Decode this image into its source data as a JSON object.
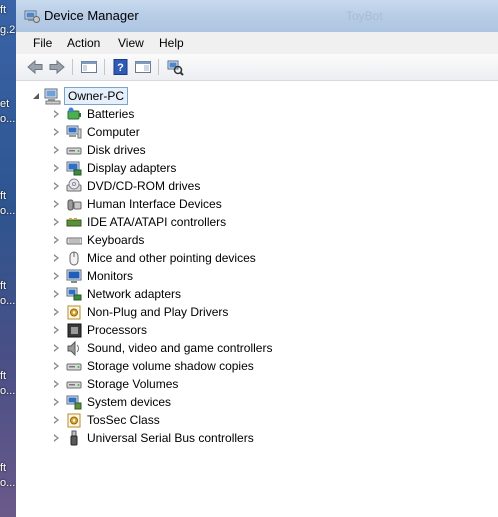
{
  "desktop": {
    "fragments": [
      "ft",
      "g.2",
      "et",
      "o...",
      "ft",
      "o...",
      "ft",
      "o...",
      "ft",
      "o...",
      "ft",
      "o..."
    ]
  },
  "window": {
    "title": "Device Manager",
    "ghost_title": "ToyBot"
  },
  "menu": {
    "file": "File",
    "action": "Action",
    "view": "View",
    "help": "Help"
  },
  "toolbar": {
    "buttons": [
      "back-icon",
      "forward-icon",
      "show-hide-console-tree-icon",
      "help-icon",
      "properties-icon",
      "scan-hardware-icon"
    ]
  },
  "tree": {
    "root": "Owner-PC",
    "items": [
      {
        "label": "Batteries",
        "icon": "battery-icon"
      },
      {
        "label": "Computer",
        "icon": "computer-icon"
      },
      {
        "label": "Disk drives",
        "icon": "disk-drive-icon"
      },
      {
        "label": "Display adapters",
        "icon": "display-adapter-icon"
      },
      {
        "label": "DVD/CD-ROM drives",
        "icon": "dvd-drive-icon"
      },
      {
        "label": "Human Interface Devices",
        "icon": "hid-icon"
      },
      {
        "label": "IDE ATA/ATAPI controllers",
        "icon": "ide-controller-icon"
      },
      {
        "label": "Keyboards",
        "icon": "keyboard-icon"
      },
      {
        "label": "Mice and other pointing devices",
        "icon": "mouse-icon"
      },
      {
        "label": "Monitors",
        "icon": "monitor-icon"
      },
      {
        "label": "Network adapters",
        "icon": "network-adapter-icon"
      },
      {
        "label": "Non-Plug and Play Drivers",
        "icon": "driver-icon"
      },
      {
        "label": "Processors",
        "icon": "processor-icon"
      },
      {
        "label": "Sound, video and game controllers",
        "icon": "sound-icon"
      },
      {
        "label": "Storage volume shadow copies",
        "icon": "storage-icon"
      },
      {
        "label": "Storage Volumes",
        "icon": "storage-icon"
      },
      {
        "label": "System devices",
        "icon": "system-device-icon"
      },
      {
        "label": "TosSec Class",
        "icon": "tossec-icon"
      },
      {
        "label": "Universal Serial Bus controllers",
        "icon": "usb-icon"
      }
    ]
  },
  "colors": {
    "titlebar": "#b7cce6",
    "selection": "#e5f0fb",
    "selection_border": "#7da2ce"
  }
}
